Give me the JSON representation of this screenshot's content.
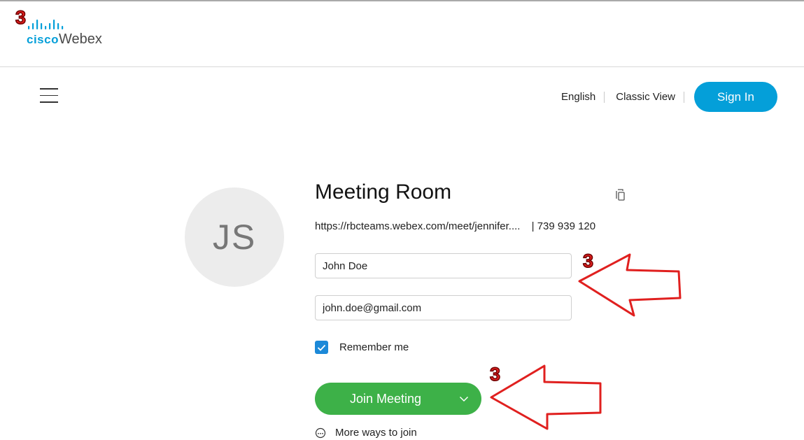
{
  "header": {
    "logo": {
      "brand": "cisco",
      "product": "Webex"
    },
    "menu_icon": "hamburger-menu-icon",
    "language": "English",
    "classic_view": "Classic View",
    "sign_in": "Sign In"
  },
  "annotations": {
    "marker_logo": "3",
    "marker_fields": "3",
    "marker_join": "3"
  },
  "meeting": {
    "avatar_initials": "JS",
    "title": "Meeting Room",
    "copy_icon": "copy-icon",
    "url": "https://rbcteams.webex.com/meet/jennifer....",
    "number": "| 739 939 120"
  },
  "form": {
    "name_value": "John Doe",
    "email_value": "john.doe@gmail.com",
    "remember_label": "Remember me",
    "remember_checked": true,
    "join_label": "Join Meeting",
    "more_ways": "More ways to join"
  },
  "colors": {
    "brand_blue": "#049fd9",
    "join_green": "#3db148",
    "checkbox_blue": "#1c89d8",
    "annotation_red": "#e0201f"
  }
}
